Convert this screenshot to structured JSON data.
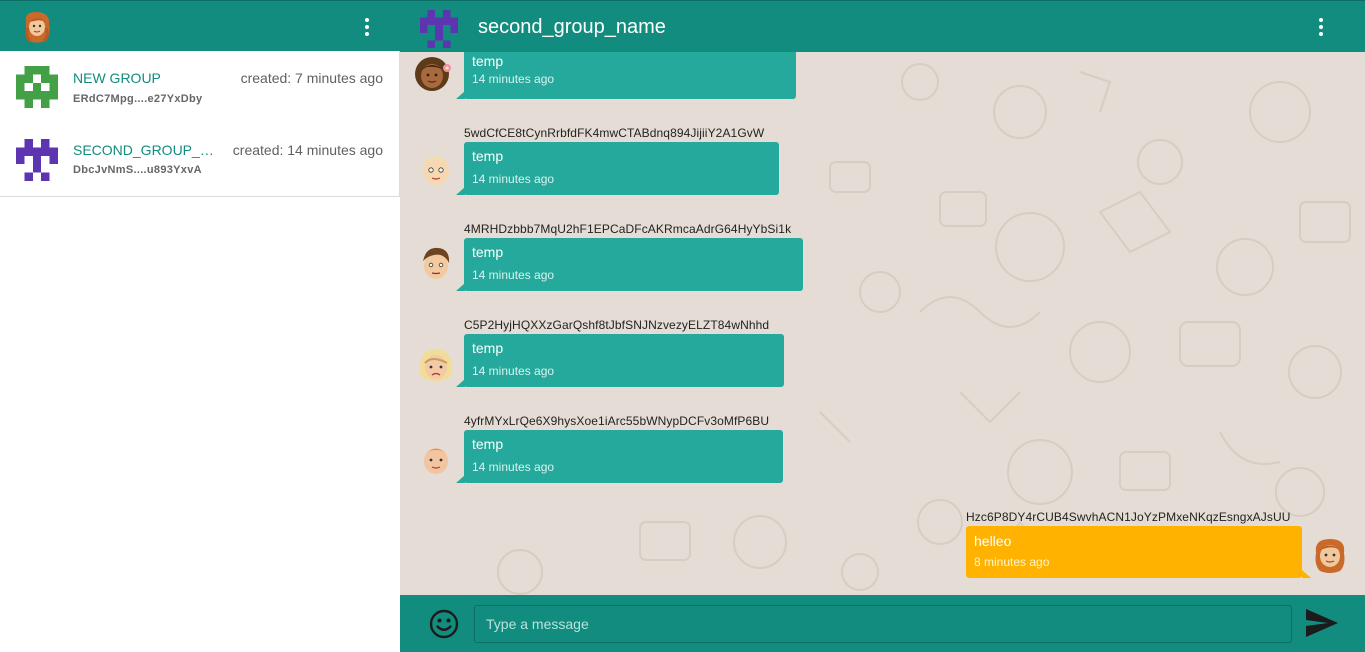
{
  "sidebar": {
    "groups": [
      {
        "name": "NEW GROUP",
        "created": "created: 7 minutes ago",
        "id": "ERdC7Mpg....e27YxDby"
      },
      {
        "name": "SECOND_GROUP_NAME",
        "created": "created: 14 minutes ago",
        "id": "DbcJvNmS....u893YxvA"
      }
    ]
  },
  "chat": {
    "title": "second_group_name",
    "messages": [
      {
        "sender": "",
        "text": "temp",
        "time": "14 minutes ago"
      },
      {
        "sender": "5wdCfCE8tCynRrbfdFK4mwCTABdnq894JijiiY2A1GvW",
        "text": "temp",
        "time": "14 minutes ago"
      },
      {
        "sender": "4MRHDzbbb7MqU2hF1EPCaDFcAKRmcaAdrG64HyYbSi1k",
        "text": "temp",
        "time": "14 minutes ago"
      },
      {
        "sender": "C5P2HyjHQXXzGarQshf8tJbfSNJNzvezyELZT84wNhhd",
        "text": "temp",
        "time": "14 minutes ago"
      },
      {
        "sender": "4yfrMYxLrQe6X9hysXoe1iArc55bWNypDCFv3oMfP6BU",
        "text": "temp",
        "time": "14 minutes ago"
      },
      {
        "sender": "Hzc6P8DY4rCUB4SwvhACN1JoYzPMxeNKqzEsngxAJsUU",
        "text": "helleo",
        "time": "8 minutes ago"
      }
    ]
  },
  "composer": {
    "placeholder": "Type a message"
  },
  "icons": {
    "menu": "more-vert-icon",
    "emoji": "emoji-smile-icon",
    "send": "send-arrow-icon"
  },
  "colors": {
    "header": "#128c7e",
    "incoming_bubble": "#25a99c",
    "outgoing_bubble": "#ffb300",
    "chat_background": "#e5ddd5"
  }
}
